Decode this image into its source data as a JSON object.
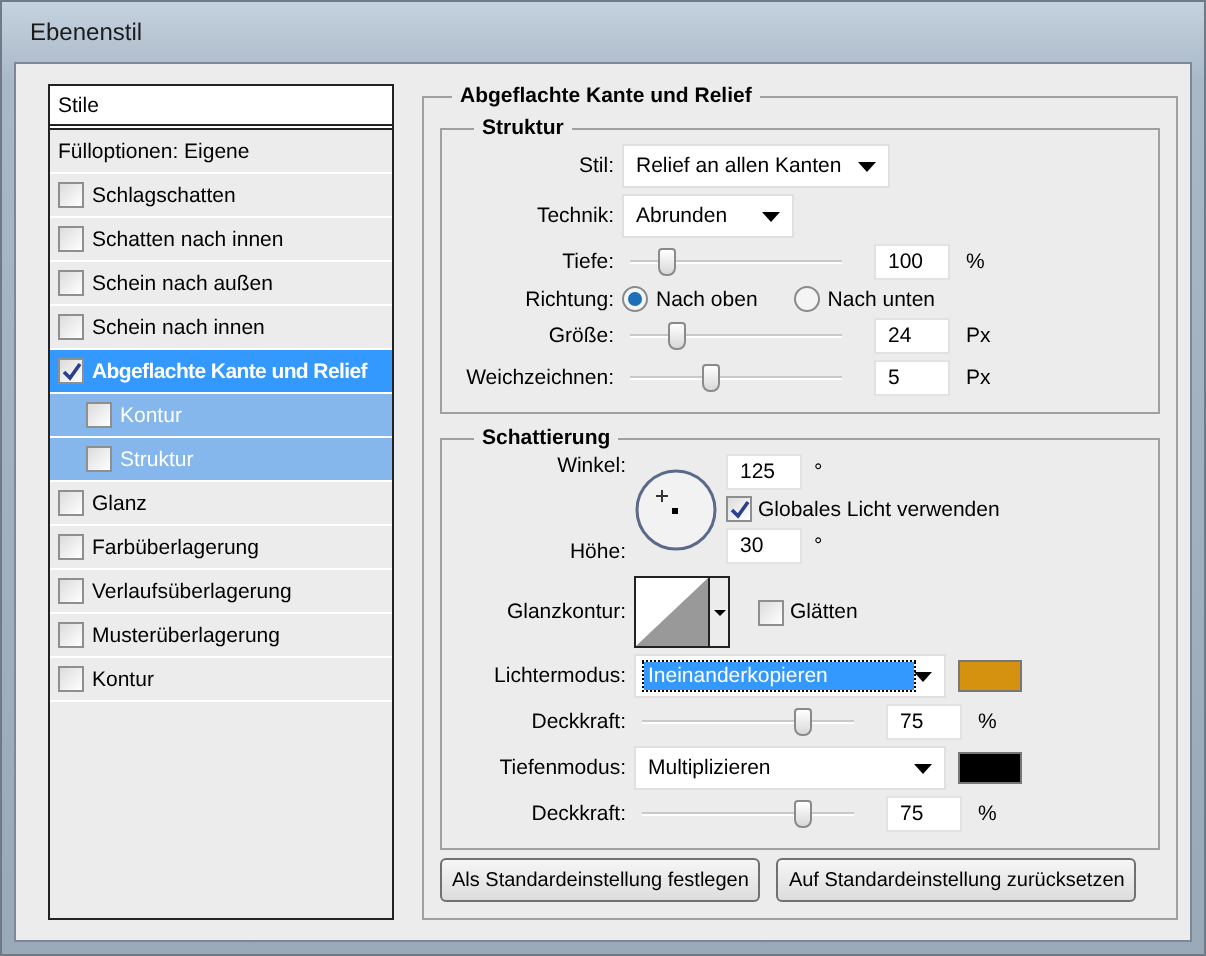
{
  "window": {
    "title": "Ebenenstil"
  },
  "styles_list": {
    "header": "Stile",
    "fill_options": "Fülloptionen: Eigene",
    "items": [
      {
        "label": "Schlagschatten",
        "checked": false,
        "selected": false
      },
      {
        "label": "Schatten nach innen",
        "checked": false,
        "selected": false
      },
      {
        "label": "Schein nach außen",
        "checked": false,
        "selected": false
      },
      {
        "label": "Schein nach innen",
        "checked": false,
        "selected": false
      },
      {
        "label": "Abgeflachte Kante und Relief",
        "checked": true,
        "selected": true,
        "children": [
          {
            "label": "Kontur",
            "checked": false,
            "selected": false
          },
          {
            "label": "Struktur",
            "checked": false,
            "selected": false
          }
        ]
      },
      {
        "label": "Glanz",
        "checked": false,
        "selected": false
      },
      {
        "label": "Farbüberlagerung",
        "checked": false,
        "selected": false
      },
      {
        "label": "Verlaufsüberlagerung",
        "checked": false,
        "selected": false
      },
      {
        "label": "Musterüberlagerung",
        "checked": false,
        "selected": false
      },
      {
        "label": "Kontur",
        "checked": false,
        "selected": false
      }
    ]
  },
  "panel": {
    "title": "Abgeflachte Kante und Relief",
    "structure": {
      "title": "Struktur",
      "style": {
        "label": "Stil:",
        "value": "Relief an allen Kanten"
      },
      "technique": {
        "label": "Technik:",
        "value": "Abrunden"
      },
      "depth": {
        "label": "Tiefe:",
        "level": 0.17,
        "value": "100",
        "unit": "%"
      },
      "direction": {
        "label": "Richtung:",
        "options": [
          {
            "label": "Nach oben",
            "selected": true
          },
          {
            "label": "Nach unten",
            "selected": false
          }
        ]
      },
      "size": {
        "label": "Größe:",
        "level": 0.22,
        "value": "24",
        "unit": "Px"
      },
      "soften": {
        "label": "Weichzeichnen:",
        "level": 0.38,
        "value": "5",
        "unit": "Px"
      }
    },
    "shading": {
      "title": "Schattierung",
      "angle": {
        "label": "Winkel:",
        "value": "125",
        "unit": "°"
      },
      "global_light": {
        "label": "Globales Licht verwenden",
        "checked": true
      },
      "altitude": {
        "label": "Höhe:",
        "value": "30",
        "unit": "°"
      },
      "gloss_contour": {
        "label": "Glanzkontur:"
      },
      "anti_aliased": {
        "label": "Glätten",
        "checked": false
      },
      "highlight_mode": {
        "label": "Lichtermodus:",
        "value": "Ineinanderkopieren",
        "focused": true,
        "color": "#d4920e"
      },
      "highlight_opacity": {
        "label": "Deckkraft:",
        "level": 0.75,
        "value": "75",
        "unit": "%"
      },
      "shadow_mode": {
        "label": "Tiefenmodus:",
        "value": "Multiplizieren",
        "focused": false,
        "color": "#000000"
      },
      "shadow_opacity": {
        "label": "Deckkraft:",
        "level": 0.75,
        "value": "75",
        "unit": "%"
      }
    },
    "buttons": [
      "Als Standardeinstellung festlegen",
      "Auf Standardeinstellung zurücksetzen"
    ]
  }
}
